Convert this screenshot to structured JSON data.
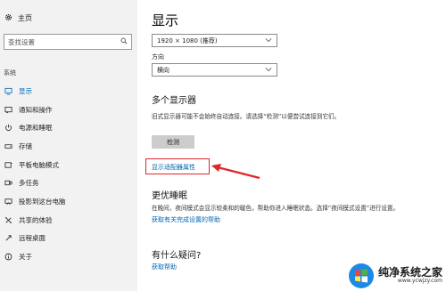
{
  "sidebar": {
    "home_label": "主页",
    "search_placeholder": "查找设置",
    "section_label": "系统",
    "items": [
      {
        "label": "显示",
        "icon": "monitor-icon"
      },
      {
        "label": "通知和操作",
        "icon": "notification-icon"
      },
      {
        "label": "电源和睡眠",
        "icon": "power-icon"
      },
      {
        "label": "存储",
        "icon": "storage-icon"
      },
      {
        "label": "平板电脑模式",
        "icon": "tablet-icon"
      },
      {
        "label": "多任务",
        "icon": "multitask-icon"
      },
      {
        "label": "投影到这台电脑",
        "icon": "project-icon"
      },
      {
        "label": "共享的体验",
        "icon": "share-icon"
      },
      {
        "label": "远程桌面",
        "icon": "remote-icon"
      },
      {
        "label": "关于",
        "icon": "info-icon"
      }
    ],
    "active_index": 0
  },
  "main": {
    "title": "显示",
    "resolution_value": "1920 × 1080 (推荐)",
    "orientation_label": "方向",
    "orientation_value": "横向",
    "multi_display_heading": "多个显示器",
    "multi_display_desc": "旧式显示器可能不会始终自动连接。请选择“检测”以便尝试连接到它们。",
    "detect_button": "检测",
    "adapter_link": "显示适配器属性",
    "sleep_heading": "更优睡眠",
    "sleep_desc": "在晚间，夜间模式会显示较柔和的暖色，帮助你进入睡眠状态。选择“夜间模式设置”进行设置。",
    "sleep_link": "获取有关完成设置的帮助",
    "question_heading": "有什么疑问?",
    "help_link": "获取帮助"
  },
  "annotation": {
    "color": "#e0262d"
  },
  "watermark": {
    "brand": "纯净系统之家",
    "url": "www.ycwjzy.com"
  },
  "colors": {
    "accent": "#0063b1",
    "sidebar_bg": "#f2f2f2"
  }
}
